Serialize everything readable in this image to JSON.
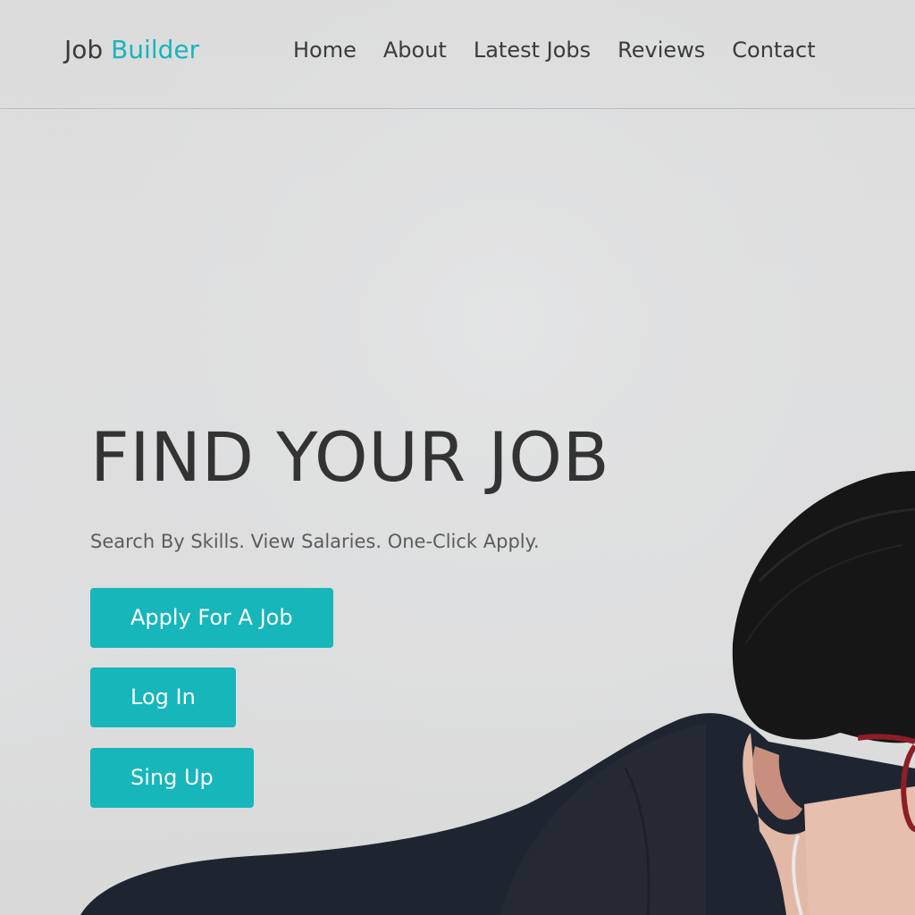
{
  "brand": {
    "word1": "Job",
    "word2": "Builder",
    "accent_color": "#16b6bb"
  },
  "nav": {
    "items": [
      {
        "label": "Home"
      },
      {
        "label": "About"
      },
      {
        "label": "Latest Jobs"
      },
      {
        "label": "Reviews"
      },
      {
        "label": "Contact"
      }
    ]
  },
  "hero": {
    "title": "FIND YOUR JOB",
    "subtitle": "Search By Skills. View Salaries. One-Click Apply.",
    "buttons": {
      "apply": "Apply For A Job",
      "login": "Log In",
      "signup": "Sing Up"
    },
    "button_color": "#16b6bb"
  }
}
